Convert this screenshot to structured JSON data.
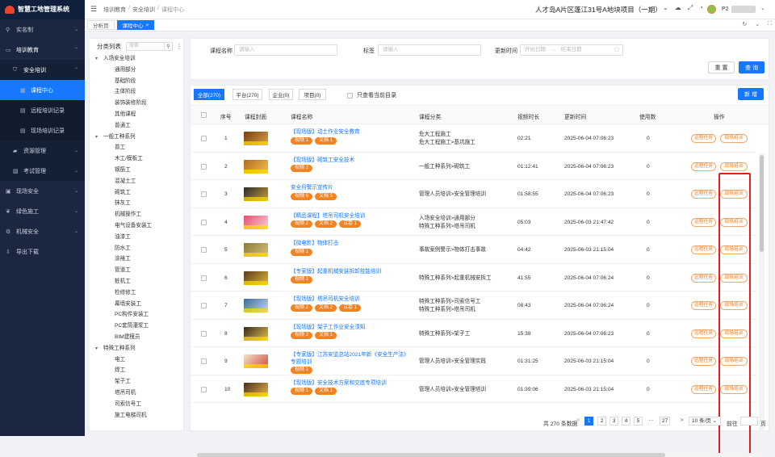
{
  "app": {
    "title": "智慧工地管理系统"
  },
  "breadcrumb": [
    "培训教育",
    "安全培训",
    "课程中心"
  ],
  "project": "人才岛A片区蓬江31号A地块项目（一期）",
  "user": {
    "name": "P2"
  },
  "tabs": [
    {
      "label": "分析页"
    },
    {
      "label": "课程中心",
      "active": true
    }
  ],
  "sidebar": {
    "items": [
      {
        "label": "实名制",
        "icon": "person-icon"
      },
      {
        "label": "培训教育",
        "icon": "book-icon",
        "open": true
      },
      {
        "label": "安全培训",
        "icon": "shield-icon",
        "open": true
      },
      {
        "label": "课程中心",
        "icon": "grid-icon",
        "active": true
      },
      {
        "label": "远程培训记录",
        "icon": "doc-icon"
      },
      {
        "label": "现场培训记录",
        "icon": "doc-icon"
      },
      {
        "label": "资源管理",
        "icon": "folder-icon"
      },
      {
        "label": "考试管理",
        "icon": "exam-icon"
      },
      {
        "label": "现场安全",
        "icon": "safety-icon"
      },
      {
        "label": "绿色施工",
        "icon": "leaf-icon"
      },
      {
        "label": "机械安全",
        "icon": "gear-icon"
      },
      {
        "label": "导出下载",
        "icon": "download-icon"
      }
    ]
  },
  "tree": {
    "title": "分类列表",
    "search_placeholder": "搜索",
    "nodes": [
      {
        "label": "入场安全培训",
        "level": 1
      },
      {
        "label": "通用部分",
        "level": 2
      },
      {
        "label": "基础阶段",
        "level": 2
      },
      {
        "label": "主体阶段",
        "level": 2
      },
      {
        "label": "装饰装修阶段",
        "level": 2
      },
      {
        "label": "其他课程",
        "level": 2
      },
      {
        "label": "普通工",
        "level": 2
      },
      {
        "label": "一般工种系列",
        "level": 1
      },
      {
        "label": "普工",
        "level": 2
      },
      {
        "label": "木工/模板工",
        "level": 2
      },
      {
        "label": "钢筋工",
        "level": 2
      },
      {
        "label": "混凝土工",
        "level": 2
      },
      {
        "label": "砌筑工",
        "level": 2
      },
      {
        "label": "抹灰工",
        "level": 2
      },
      {
        "label": "机械操作工",
        "level": 2
      },
      {
        "label": "电气设备安装工",
        "level": 2
      },
      {
        "label": "油漆工",
        "level": 2
      },
      {
        "label": "防水工",
        "level": 2
      },
      {
        "label": "涂裱工",
        "level": 2
      },
      {
        "label": "管道工",
        "level": 2
      },
      {
        "label": "桩机工",
        "level": 2
      },
      {
        "label": "检修修工",
        "level": 2
      },
      {
        "label": "幕墙安装工",
        "level": 2
      },
      {
        "label": "PC构件安装工",
        "level": 2
      },
      {
        "label": "PC套筒灌浆工",
        "level": 2
      },
      {
        "label": "BIM建模员",
        "level": 2
      },
      {
        "label": "特殊工种系列",
        "level": 1
      },
      {
        "label": "电工",
        "level": 2
      },
      {
        "label": "焊工",
        "level": 2
      },
      {
        "label": "架子工",
        "level": 2
      },
      {
        "label": "塔吊司机",
        "level": 2
      },
      {
        "label": "司索信号工",
        "level": 2
      },
      {
        "label": "施工电梯司机",
        "level": 2
      }
    ]
  },
  "filter": {
    "name_label": "课程名称",
    "name_placeholder": "请输入",
    "tag_label": "标签",
    "tag_placeholder": "请输入",
    "time_label": "更新时间",
    "start_placeholder": "开始日期",
    "range_sep": "→",
    "end_placeholder": "结束日期",
    "reset": "重 置",
    "search": "查 询"
  },
  "list_tabs": [
    {
      "label": "全部(270)",
      "active": true
    },
    {
      "label": "平台(270)"
    },
    {
      "label": "企业(0)"
    },
    {
      "label": "项目(0)"
    }
  ],
  "only_current": "只查看当前目录",
  "add_button": "新 增",
  "columns": {
    "index": "序号",
    "cover": "课程封面",
    "name": "课程名称",
    "category": "课程分类",
    "duration": "视频时长",
    "updated": "更新时间",
    "used": "使用数",
    "ops": "操作"
  },
  "ops": {
    "remote": "远程任务",
    "onsite": "现场培训"
  },
  "rows": [
    {
      "index": "1",
      "name": "【现场版】动土作业安全教育",
      "tags": [
        "视频 1",
        "文档 1"
      ],
      "category": [
        "危大工程施工",
        "危大工程施工>基坑施工"
      ],
      "duration": "02:21",
      "updated": "2025-06-04 07:06:23",
      "used": "0"
    },
    {
      "index": "2",
      "name": "【现场版】砌筑工安全技术",
      "tags": [
        "视频 2"
      ],
      "category": [
        "一般工种系列>砌筑工"
      ],
      "duration": "01:12:41",
      "updated": "2025-06-04 07:06:23",
      "used": "0"
    },
    {
      "index": "3",
      "name": "安全月警示宣传片",
      "tags": [
        "视频 6",
        "文档 5"
      ],
      "category": [
        "管理人员培训>安全管理培训"
      ],
      "duration": "01:58:55",
      "updated": "2025-06-04 07:06:23",
      "used": "0"
    },
    {
      "index": "4",
      "name": "【精品课程】塔吊司机安全培训",
      "tags": [
        "视频 2",
        "文档 2",
        "试卷 1"
      ],
      "category": [
        "入场安全培训>通用部分",
        "特殊工种系列>塔吊司机"
      ],
      "duration": "05:03",
      "updated": "2025-06-03 21:47:42",
      "used": "0"
    },
    {
      "index": "5",
      "name": "【微电影】物体打击",
      "tags": [
        "视频 1"
      ],
      "category": [
        "事故案例警示>物体打击事故"
      ],
      "duration": "04:42",
      "updated": "2025-06-03 21:15:04",
      "used": "0"
    },
    {
      "index": "6",
      "name": "【专家版】起重机械安装拆卸技能培训",
      "tags": [
        "视频 1"
      ],
      "category": [
        "特殊工种系列>起重机械安拆工"
      ],
      "duration": "41:55",
      "updated": "2025-06-04 07:06:24",
      "used": "0"
    },
    {
      "index": "7",
      "name": "【现场版】塔吊司机安全培训",
      "tags": [
        "视频 2",
        "文档 2",
        "试卷 1"
      ],
      "category": [
        "特殊工种系列>司索信号工",
        "特殊工种系列>塔吊司机"
      ],
      "duration": "08:43",
      "updated": "2025-06-04 07:06:24",
      "used": "0"
    },
    {
      "index": "8",
      "name": "【现场版】架子工作业安全须知",
      "tags": [
        "视频 2",
        "文档 1"
      ],
      "category": [
        "特殊工种系列>架子工"
      ],
      "duration": "15:38",
      "updated": "2025-06-04 07:06:23",
      "used": "0"
    },
    {
      "index": "9",
      "name": "【专家版】江苏安监总站2021年新《安全生产法》专题培训",
      "tags": [
        "视频 1"
      ],
      "category": [
        "管理人员培训>安全管理实践"
      ],
      "duration": "01:31:25",
      "updated": "2025-06-03 21:15:04",
      "used": "0"
    },
    {
      "index": "10",
      "name": "【现场版】安全技术方案和交底专项培训",
      "tags": [
        "视频 1",
        "文档 1"
      ],
      "category": [
        "管理人员培训>安全管理培训"
      ],
      "duration": "01:39:06",
      "updated": "2025-06-03 21:15:04",
      "used": "0"
    }
  ],
  "pager": {
    "total": "共 270 条数据",
    "pages": [
      "1",
      "2",
      "3",
      "4",
      "5",
      "···",
      "27"
    ],
    "prev": "<",
    "next": ">",
    "size": "10 条/页",
    "goto_label": "前往",
    "goto_suffix": "页"
  },
  "colors": {
    "primary": "#1677ff",
    "sidebar": "#1b2740",
    "tag": "#f58220",
    "highlight": "#e02020"
  }
}
